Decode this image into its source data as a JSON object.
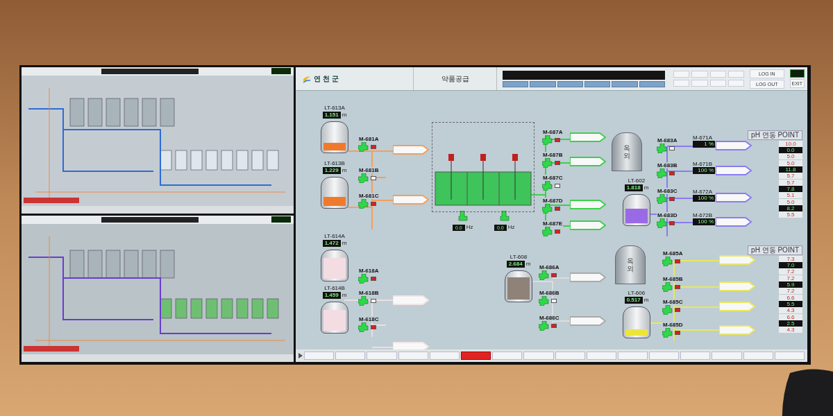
{
  "header": {
    "district": "연 천 군",
    "screen_title": "약품공급",
    "account_buttons": [
      {
        "label": "LOG IN"
      },
      {
        "label": "LOG OUT"
      }
    ],
    "exit": "EXIT"
  },
  "tanks": [
    {
      "tag": "LT-613A",
      "reading": "1.151",
      "unit": "m",
      "level": 0.3,
      "color": "#f07a2c"
    },
    {
      "tag": "LT-613B",
      "reading": "1.229",
      "unit": "m",
      "level": 0.35,
      "color": "#f07a2c"
    },
    {
      "tag": "LT-614A",
      "reading": "1.472",
      "unit": "m",
      "level": 0.8,
      "color": "#f3dde3"
    },
    {
      "tag": "LT-614B",
      "reading": "1.459",
      "unit": "m",
      "level": 0.8,
      "color": "#f3dde3"
    },
    {
      "tag": "LT-608",
      "reading": "2.684",
      "unit": "m",
      "level": 0.85,
      "color": "#8f8279"
    },
    {
      "tag": "LT-602",
      "reading": "1.818",
      "unit": "m",
      "level": 0.55,
      "color": "#9a6ae6"
    },
    {
      "tag": "LT-606",
      "reading": "0.517",
      "unit": "m",
      "level": 0.25,
      "color": "#ece63a"
    }
  ],
  "silos": [
    {
      "label": "옥 외"
    },
    {
      "label": "옥 외"
    }
  ],
  "pumps": [
    {
      "tag": "M-681A",
      "running": true,
      "alarm": true
    },
    {
      "tag": "M-681B",
      "running": true,
      "alarm": false
    },
    {
      "tag": "M-681C",
      "running": true,
      "alarm": true
    },
    {
      "tag": "M-618A",
      "running": true,
      "alarm": true
    },
    {
      "tag": "M-618B",
      "running": true,
      "alarm": false
    },
    {
      "tag": "M-618C",
      "running": true,
      "alarm": true
    },
    {
      "tag": "M-687A",
      "running": true,
      "alarm": true
    },
    {
      "tag": "M-687B",
      "running": true,
      "alarm": true
    },
    {
      "tag": "M-687C",
      "running": true,
      "alarm": false
    },
    {
      "tag": "M-687D",
      "running": true,
      "alarm": true
    },
    {
      "tag": "M-687E",
      "running": true,
      "alarm": true
    },
    {
      "tag": "M-683A",
      "running": true,
      "alarm": false
    },
    {
      "tag": "M-683B",
      "running": true,
      "alarm": true
    },
    {
      "tag": "M-683C",
      "running": true,
      "alarm": true
    },
    {
      "tag": "M-683D",
      "running": true,
      "alarm": true
    },
    {
      "tag": "M-685A",
      "running": true,
      "alarm": true
    },
    {
      "tag": "M-685B",
      "running": true,
      "alarm": true
    },
    {
      "tag": "M-685C",
      "running": true,
      "alarm": true
    },
    {
      "tag": "M-685D",
      "running": true,
      "alarm": true
    },
    {
      "tag": "M-686A",
      "running": true,
      "alarm": true
    },
    {
      "tag": "M-686B",
      "running": true,
      "alarm": false
    },
    {
      "tag": "M-686C",
      "running": true,
      "alarm": true
    }
  ],
  "drives": [
    {
      "tag": "M-671A",
      "reading": "1 %"
    },
    {
      "tag": "M-671B",
      "reading": "100 %"
    },
    {
      "tag": "M-672A",
      "reading": "100 %"
    },
    {
      "tag": "M-672B",
      "reading": "100 %"
    }
  ],
  "dosing_pumps": [
    {
      "reading": "0.0",
      "unit": "Hz"
    },
    {
      "reading": "0.0",
      "unit": "Hz"
    }
  ],
  "ph_sections": [
    {
      "title": "pH 연동 POINT",
      "points": [
        {
          "high": "10.0",
          "value": "0.0",
          "low": "5.0"
        },
        {
          "high": "5.0",
          "value": "11.8",
          "low": "5.7"
        },
        {
          "high": "5.7",
          "value": "7.8",
          "low": "5.1"
        },
        {
          "high": "5.0",
          "value": "8.2",
          "low": "5.5"
        }
      ]
    },
    {
      "title": "pH 연동 POINT",
      "points": [
        {
          "high": "7.3",
          "value": "7.0",
          "low": "7.2"
        },
        {
          "high": "7.2",
          "value": "5.9",
          "low": "7.2"
        },
        {
          "high": "6.6",
          "value": "5.5",
          "low": "4.3"
        },
        {
          "high": "6.6",
          "value": "2.5",
          "low": "4.3"
        }
      ]
    }
  ],
  "tabs": [
    {
      "selected": false
    },
    {
      "selected": false
    },
    {
      "selected": false
    },
    {
      "selected": false
    },
    {
      "selected": false
    },
    {
      "selected": true
    },
    {
      "selected": false
    },
    {
      "selected": false
    },
    {
      "selected": false
    },
    {
      "selected": false
    },
    {
      "selected": false
    },
    {
      "selected": false
    },
    {
      "selected": false
    },
    {
      "selected": false
    },
    {
      "selected": false
    },
    {
      "selected": false
    }
  ]
}
